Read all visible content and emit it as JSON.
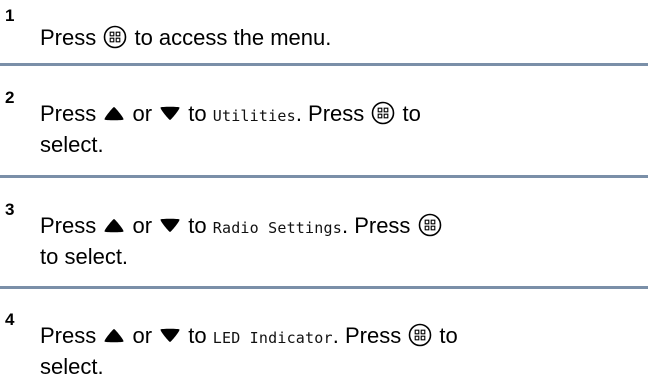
{
  "steps": [
    {
      "number": "1",
      "parts": [
        "Press ",
        "menu-ok-button-icon",
        " to access the menu."
      ]
    },
    {
      "number": "2",
      "line1": {
        "press": "Press ",
        "or": " or ",
        "to": " to ",
        "item": "Utilities",
        "press2": ". Press ",
        "to2": " to"
      },
      "line2": "select."
    },
    {
      "number": "3",
      "line1": {
        "press": "Press ",
        "or": " or ",
        "to": " to ",
        "item": "Radio Settings",
        "press2": ". Press "
      },
      "line2": "to select."
    },
    {
      "number": "4",
      "line1": {
        "press": "Press ",
        "or": " or ",
        "to": " to ",
        "item": "LED Indicator",
        "press2": ". Press ",
        "to2": " to"
      },
      "line2": "select."
    }
  ],
  "icons": {
    "menu_button": "menu-ok-button-icon",
    "up": "up-arrow-icon",
    "down": "down-arrow-icon"
  },
  "colors": {
    "divider": "#7a8fa8",
    "text": "#000000"
  }
}
